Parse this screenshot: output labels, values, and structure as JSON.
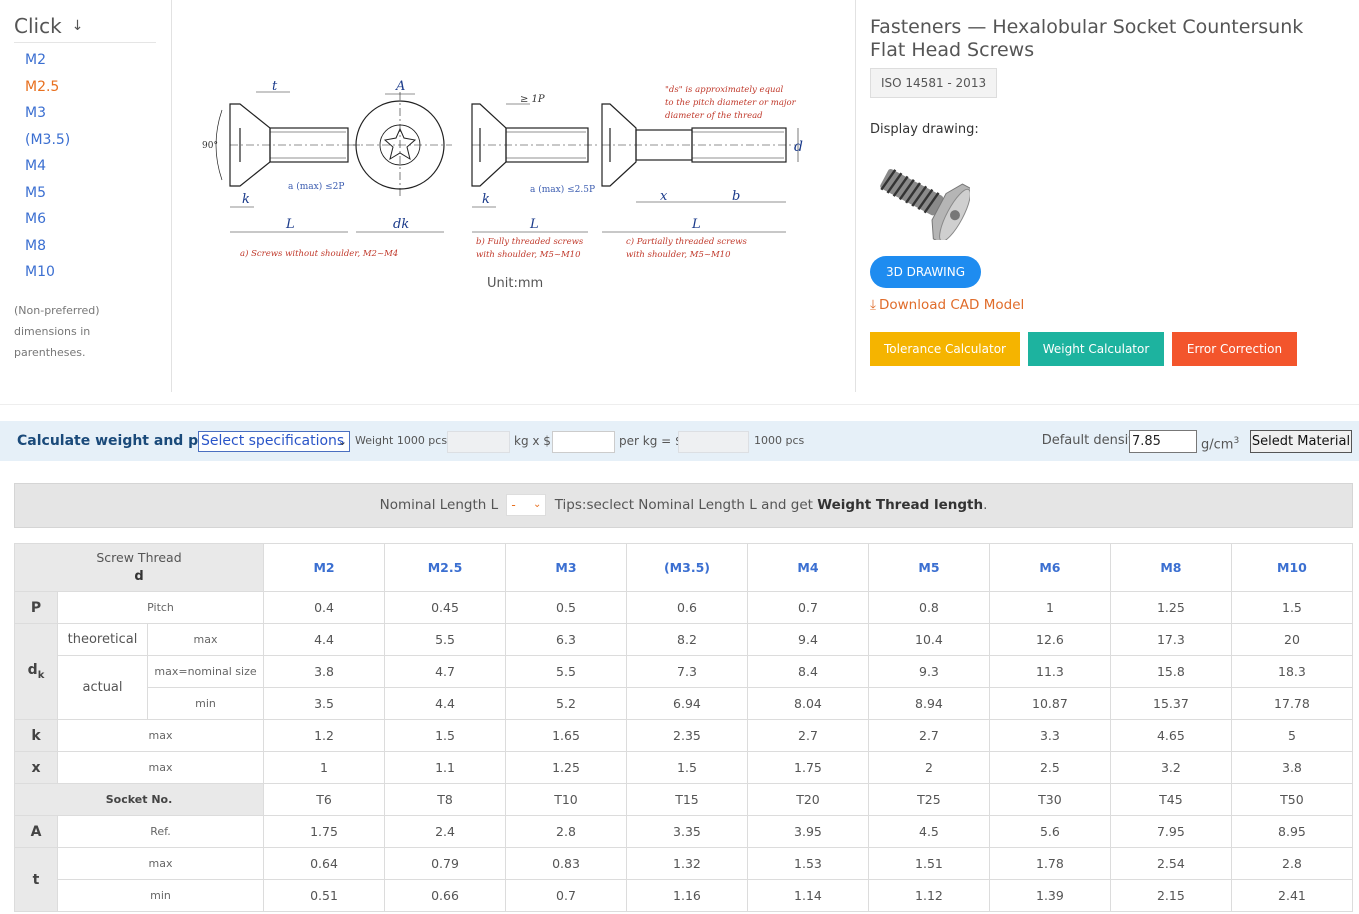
{
  "sidebar": {
    "title": "Click",
    "sizes": [
      "M2",
      "M2.5",
      "M3",
      "(M3.5)",
      "M4",
      "M5",
      "M6",
      "M8",
      "M10"
    ],
    "active": "M2.5",
    "note1": "(Non-preferred)",
    "note2": "dimensions in parentheses."
  },
  "drawing": {
    "unit": "Unit:mm",
    "caption_a": "a) Screws without shoulder, M2~M4",
    "caption_b1": "b) Fully threaded screws",
    "caption_b2": "with shoulder, M5~M10",
    "caption_c1": "c) Partially threaded screws",
    "caption_c2": "with shoulder, M5~M10",
    "note1": "\"ds\" is approximately equal",
    "note2": "to the pitch diameter or major",
    "note3": "diameter of the thread",
    "lbl_t": "t",
    "lbl_A": "A",
    "lbl_1P": "≥ 1P",
    "lbl_d": "d",
    "lbl_angle": "90°",
    "lbl_amax1": "a (max) ≤2P",
    "lbl_amax2": "a (max) ≤2.5P",
    "lbl_k": "k",
    "lbl_L": "L",
    "lbl_dk": "dk",
    "lbl_x": "x",
    "lbl_b": "b"
  },
  "product": {
    "title": "Fasteners — Hexalobular Socket Countersunk Flat Head Screws",
    "standard": "ISO 14581 - 2013",
    "display_label": "Display drawing:",
    "btn_3d": "3D DRAWING",
    "download": "Download CAD Model",
    "btn_tolerance": "Tolerance Calculator",
    "btn_weight": "Weight Calculator",
    "btn_error": "Error Correction"
  },
  "calc": {
    "title": "Calculate weight and price.",
    "select": "Select specifications",
    "weight_lbl": "Weight 1000 pcs :",
    "kg_x": "kg x $",
    "per_kg": "per kg = $",
    "pcs_lbl": "1000 pcs",
    "density_lbl": "Default density",
    "density_val": "7.85",
    "density_unit": "g/cm",
    "density_sup": "3",
    "material_btn": "Seledt Material"
  },
  "nominal": {
    "label": "Nominal Length L",
    "value": "-",
    "tip": "Tips:seclect Nominal Length L and get",
    "tip_bold": "Weight Thread length",
    "tip_end": "."
  },
  "table": {
    "header_top": "Screw Thread",
    "header_sym": "d",
    "sizes": [
      "M2",
      "M2.5",
      "M3",
      "(M3.5)",
      "M4",
      "M5",
      "M6",
      "M8",
      "M10"
    ],
    "P": {
      "sym": "P",
      "label": "Pitch",
      "values": [
        "0.4",
        "0.45",
        "0.5",
        "0.6",
        "0.7",
        "0.8",
        "1",
        "1.25",
        "1.5"
      ]
    },
    "dk": {
      "sym": "d",
      "sub": "k",
      "theoretical": "theoretical",
      "actual": "actual",
      "max_lbl": "max",
      "nom_lbl": "max=nominal size",
      "min_lbl": "min",
      "theo_max": [
        "4.4",
        "5.5",
        "6.3",
        "8.2",
        "9.4",
        "10.4",
        "12.6",
        "17.3",
        "20"
      ],
      "act_max": [
        "3.8",
        "4.7",
        "5.5",
        "7.3",
        "8.4",
        "9.3",
        "11.3",
        "15.8",
        "18.3"
      ],
      "act_min": [
        "3.5",
        "4.4",
        "5.2",
        "6.94",
        "8.04",
        "8.94",
        "10.87",
        "15.37",
        "17.78"
      ]
    },
    "k": {
      "sym": "k",
      "label": "max",
      "values": [
        "1.2",
        "1.5",
        "1.65",
        "2.35",
        "2.7",
        "2.7",
        "3.3",
        "4.65",
        "5"
      ]
    },
    "x": {
      "sym": "x",
      "label": "max",
      "values": [
        "1",
        "1.1",
        "1.25",
        "1.5",
        "1.75",
        "2",
        "2.5",
        "3.2",
        "3.8"
      ]
    },
    "socket": {
      "label": "Socket No.",
      "values": [
        "T6",
        "T8",
        "T10",
        "T15",
        "T20",
        "T25",
        "T30",
        "T45",
        "T50"
      ]
    },
    "A": {
      "sym": "A",
      "label": "Ref.",
      "values": [
        "1.75",
        "2.4",
        "2.8",
        "3.35",
        "3.95",
        "4.5",
        "5.6",
        "7.95",
        "8.95"
      ]
    },
    "t": {
      "sym": "t",
      "max_lbl": "max",
      "min_lbl": "min",
      "max": [
        "0.64",
        "0.79",
        "0.83",
        "1.32",
        "1.53",
        "1.51",
        "1.78",
        "2.54",
        "2.8"
      ],
      "min": [
        "0.51",
        "0.66",
        "0.7",
        "1.16",
        "1.14",
        "1.12",
        "1.39",
        "2.15",
        "2.41"
      ]
    }
  },
  "colors": {
    "link": "#3b6fd1",
    "active": "#e8701f",
    "btn_3d": "#1e8cf0",
    "btn_tolerance": "#f5b400",
    "btn_weight": "#1db39f",
    "btn_error": "#f3552c",
    "calc_bg": "#e6f0f8"
  }
}
